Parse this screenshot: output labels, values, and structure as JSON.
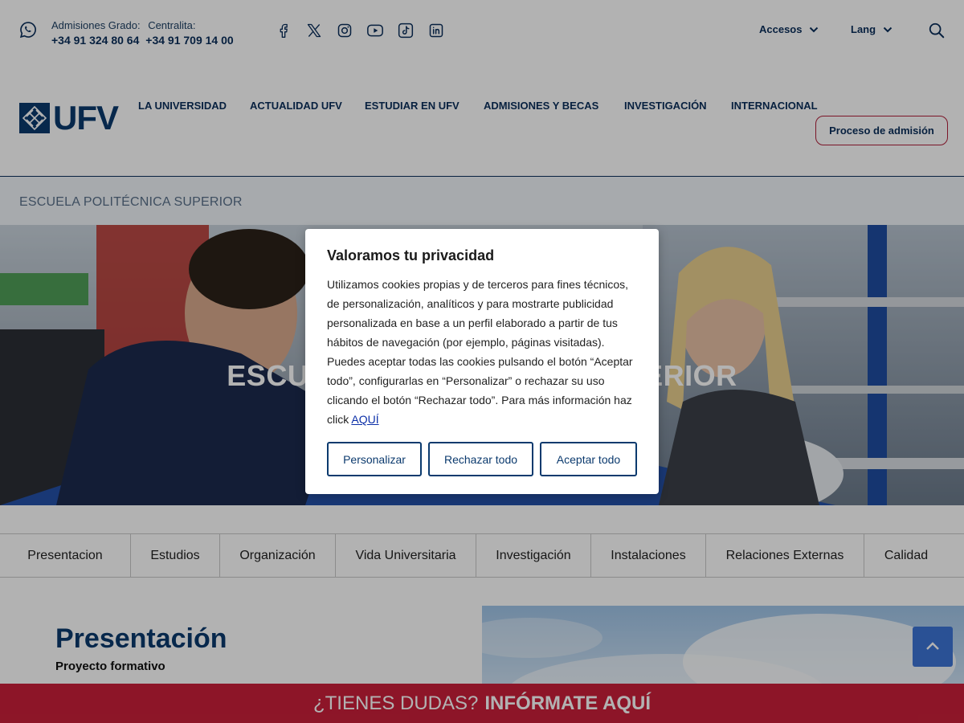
{
  "topbar": {
    "admissions_label": "Admisiones Grado:",
    "switchboard_label": "Centralita:",
    "admissions_phone": "+34 91 324 80 64",
    "switchboard_phone": "+34 91 709 14 00",
    "socials": [
      "facebook-icon",
      "x-twitter-icon",
      "instagram-icon",
      "youtube-icon",
      "tiktok-icon",
      "linkedin-icon"
    ],
    "access_label": "Accesos",
    "lang_label": "Lang"
  },
  "header": {
    "logo_text": "UFV",
    "nav": [
      "LA UNIVERSIDAD",
      "ACTUALIDAD UFV",
      "ESTUDIAR EN UFV",
      "ADMISIONES Y BECAS",
      "INVESTIGACIÓN",
      "INTERNACIONAL"
    ],
    "cta_label": "Proceso de admisión"
  },
  "breadcrumb": "ESCUELA POLITÉCNICA SUPERIOR",
  "hero": {
    "title": "ESCUELA POLITÉCNICA SUPERIOR"
  },
  "tabs": [
    "Presentacion",
    "Estudios",
    "Organización",
    "Vida Universitaria",
    "Investigación",
    "Instalaciones",
    "Relaciones Externas",
    "Calidad"
  ],
  "presentation": {
    "title": "Presentación",
    "subtitle": "Proyecto formativo"
  },
  "banner": {
    "prefix": "¿TIENES DUDAS?",
    "strong": "INFÓRMATE AQUÍ"
  },
  "cookie_modal": {
    "title": "Valoramos tu privacidad",
    "body": "Utilizamos cookies propias y de terceros para fines técnicos, de personalización, analíticos y para mostrarte publicidad personalizada en base a un perfil elaborado a partir de tus hábitos de navegación (por ejemplo, páginas visitadas). Puedes aceptar todas las cookies pulsando el botón “Aceptar todo”, configurarlas en “Personalizar” o rechazar su uso clicando el botón “Rechazar todo”. Para más información haz click",
    "link_label": "AQUÍ",
    "customize_label": "Personalizar",
    "reject_label": "Rechazar todo",
    "accept_label": "Aceptar todo"
  },
  "colors": {
    "brand_navy": "#0b3a6e",
    "accent_red": "#ca1f3a",
    "back_to_top": "#3d74d6"
  }
}
